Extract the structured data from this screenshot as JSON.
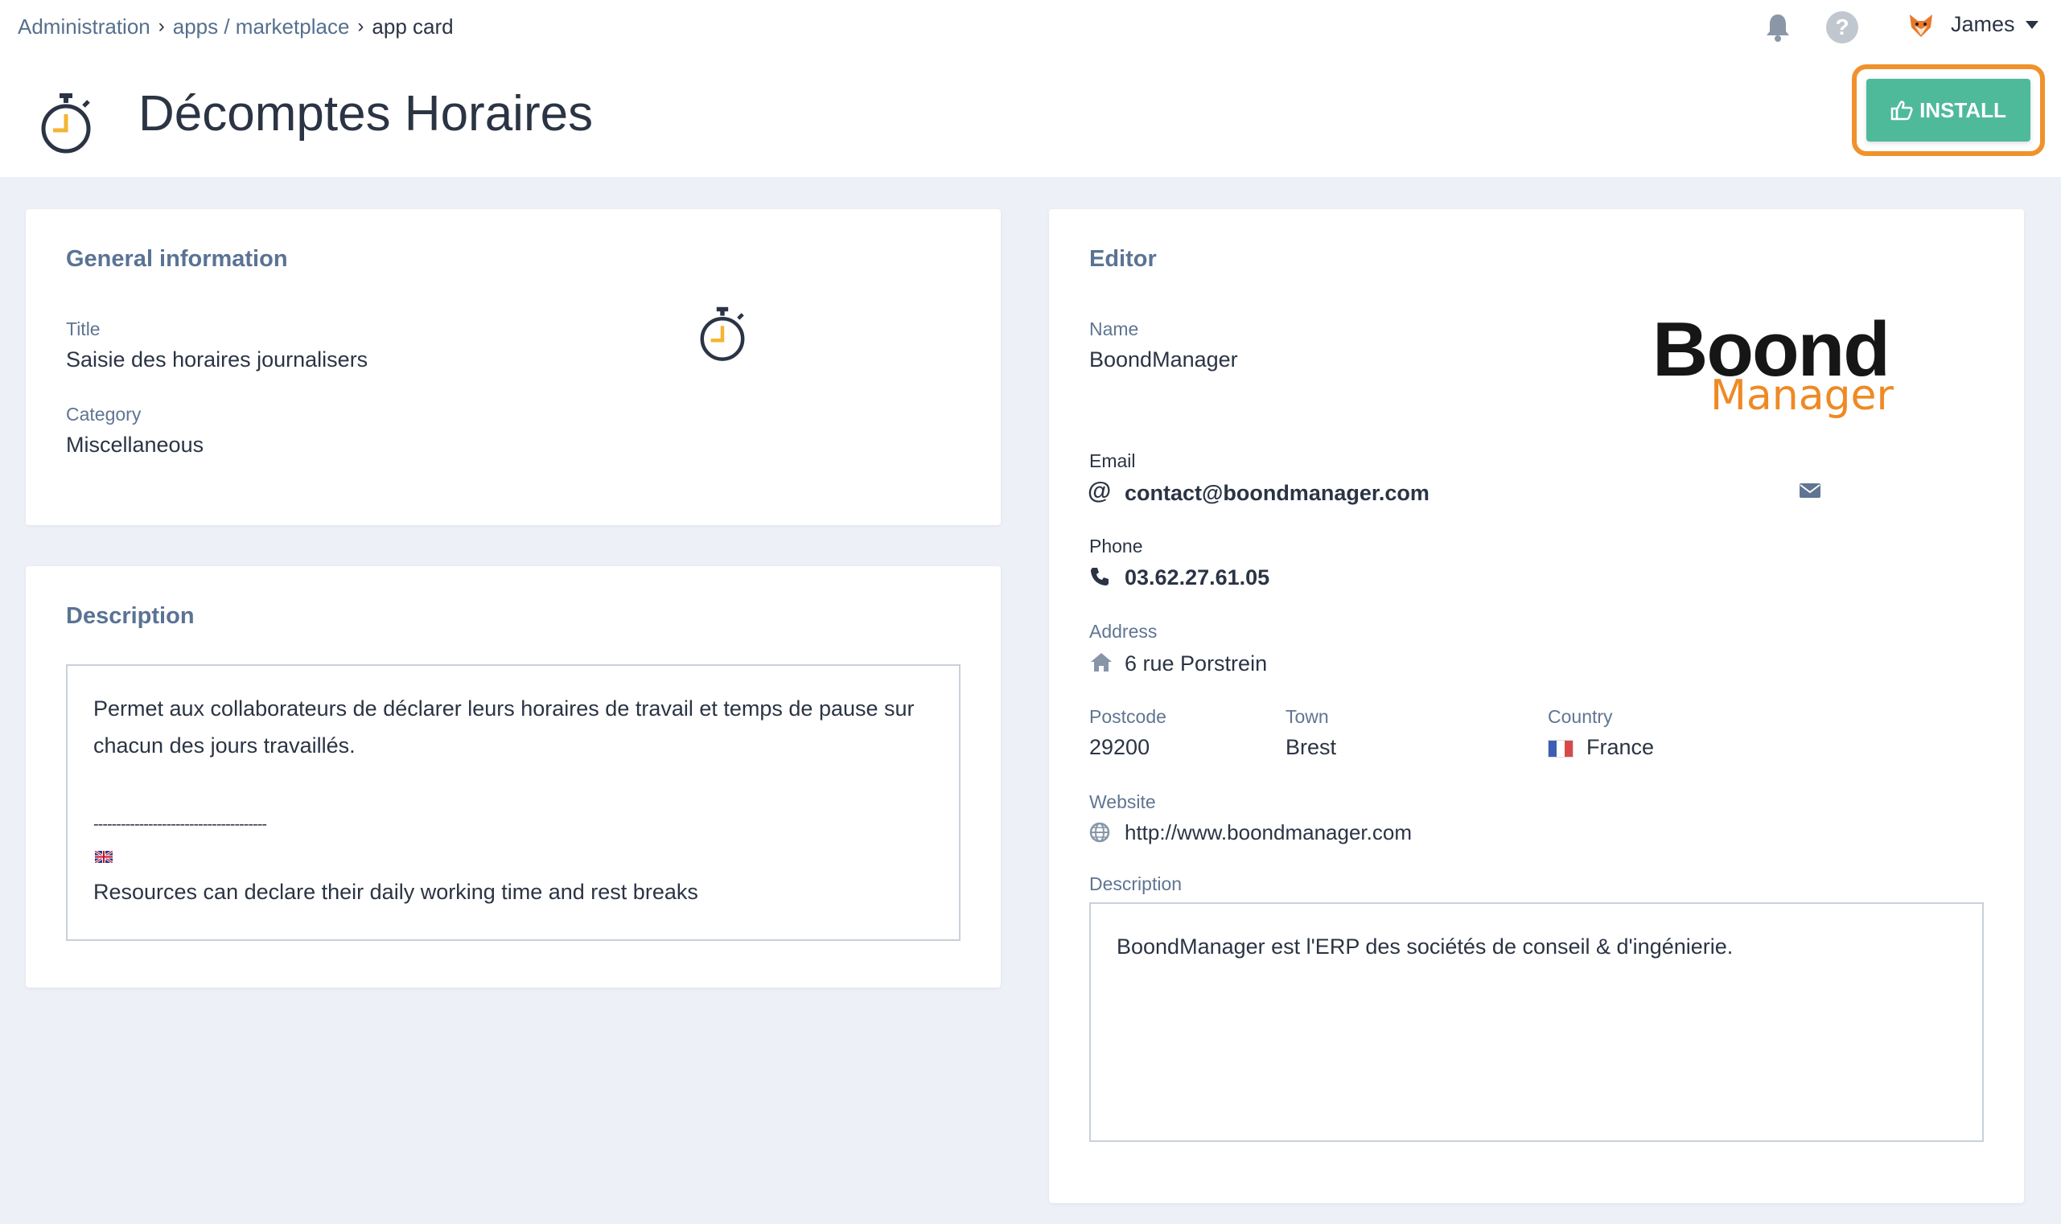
{
  "breadcrumb": {
    "items": [
      "Administration",
      "apps / marketplace",
      "app card"
    ]
  },
  "topbar": {
    "bell_icon": "bell-icon",
    "help_label": "?",
    "user_name": "James"
  },
  "app": {
    "title": "Décomptes Horaires",
    "install_label": "INSTALL"
  },
  "general_info": {
    "heading": "General information",
    "title_label": "Title",
    "title_value": "Saisie des horaires journalisers",
    "category_label": "Category",
    "category_value": "Miscellaneous"
  },
  "description": {
    "heading": "Description",
    "paragraph_fr": "Permet aux collaborateurs de déclarer leurs horaires de travail et temps de pause sur chacun des jours travaillés.",
    "separator": "--------------------------------------",
    "paragraph_en": "Resources can declare their daily working time and rest breaks"
  },
  "editor": {
    "heading": "Editor",
    "name_label": "Name",
    "name_value": "BoondManager",
    "logo_word1": "Boond",
    "logo_word2": "Manager",
    "email_label": "Email",
    "email_value": "contact@boondmanager.com",
    "phone_label": "Phone",
    "phone_value": "03.62.27.61.05",
    "address_label": "Address",
    "address_value": "6 rue Porstrein",
    "postcode_label": "Postcode",
    "postcode_value": "29200",
    "town_label": "Town",
    "town_value": "Brest",
    "country_label": "Country",
    "country_value": "France",
    "website_label": "Website",
    "website_value": "http://www.boondmanager.com",
    "description_label": "Description",
    "description_value": "BoondManager est l'ERP des sociétés de conseil & d'ingénierie."
  },
  "colors": {
    "accent_install": "#4eba9a",
    "highlight_border": "#f0922c",
    "logo_orange": "#ee8a24",
    "heading_blue": "#5a7394"
  }
}
